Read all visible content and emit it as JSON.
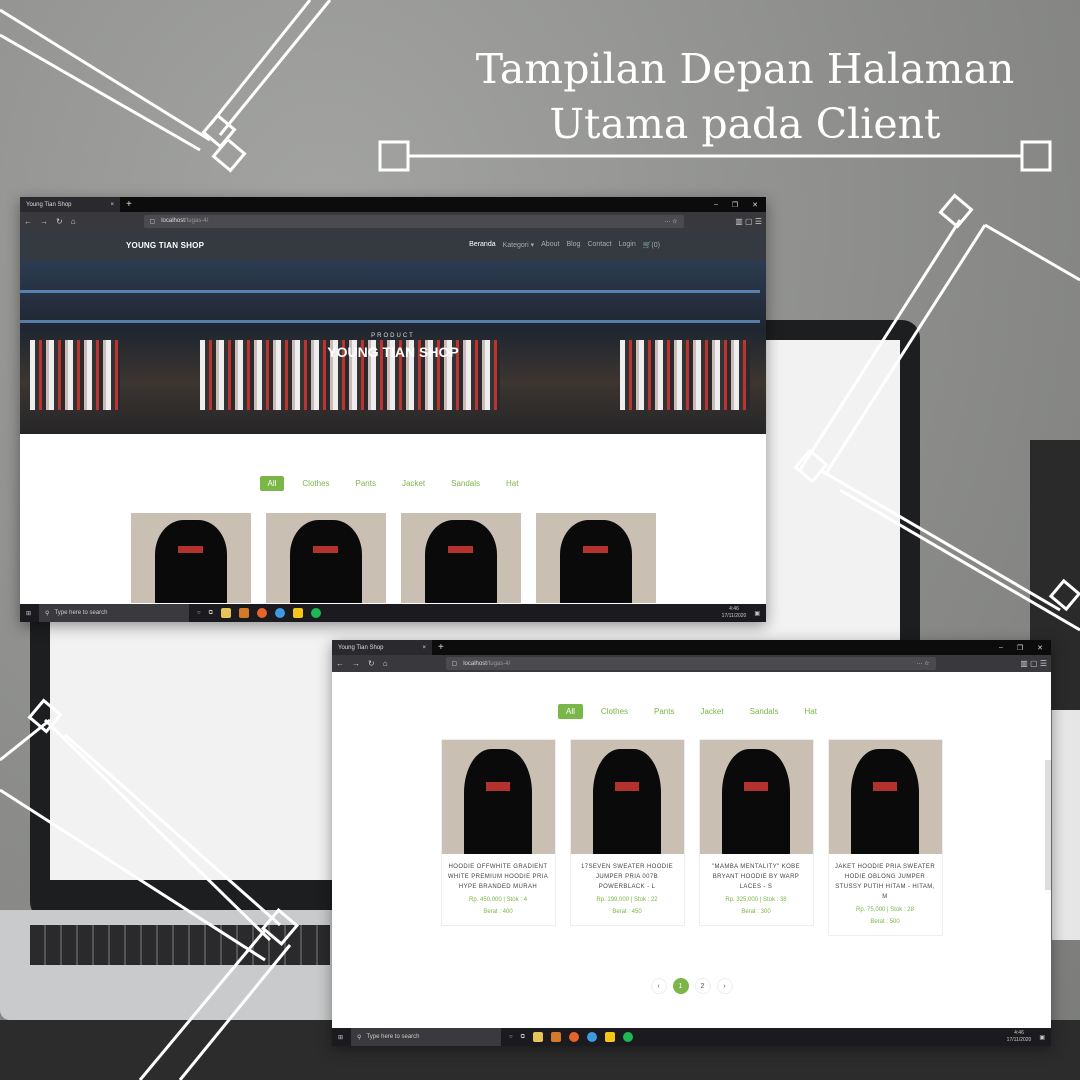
{
  "title": {
    "line1": "Tampilan Depan Halaman",
    "line2": "Utama pada Client"
  },
  "browser": {
    "tab": "Young Tian Shop",
    "close": "×",
    "new_tab": "+",
    "url_host": "localhost",
    "url_path": "/tugas-4/",
    "min": "–",
    "max": "❐",
    "close_win": "✕"
  },
  "nav": {
    "brand": "YOUNG TIAN SHOP",
    "items": [
      "Beranda",
      "Kategori ▾",
      "About",
      "Blog",
      "Contact",
      "Login",
      "🛒(0)"
    ]
  },
  "hero": {
    "subtitle": "PRODUCT",
    "heading": "YOUNG TIAN SHOP"
  },
  "filters": [
    "All",
    "Clothes",
    "Pants",
    "Jacket",
    "Sandals",
    "Hat"
  ],
  "products": [
    {
      "name": "HOODIE OFFWHITE GRADIENT WHITE PREMIUM HOODIE PRIA HYPE BRANDED MURAH",
      "price": "Rp. 450,000 | Stok : 4",
      "weight": "Berat : 400"
    },
    {
      "name": "17SEVEN SWEATER HOODIE JUMPER PRIA 007B POWERBLACK - L",
      "price": "Rp. 199,000 | Stok : 22",
      "weight": "Berat : 450"
    },
    {
      "name": "\"MAMBA MENTALITY\" KOBE BRYANT HOODIE BY WARP LACES - S",
      "price": "Rp. 325,000 | Stok : 38",
      "weight": "Berat : 300"
    },
    {
      "name": "JAKET HOODIE PRIA SWEATER HODIE OBLONG JUMPER STUSSY PUTIH HITAM - HITAM, M",
      "price": "Rp. 75,000 | Stok : 28",
      "weight": "Berat : 500"
    }
  ],
  "pagination": {
    "prev": "‹",
    "pages": [
      "1",
      "2"
    ],
    "next": "›"
  },
  "taskbar": {
    "search_placeholder": "Type here to search",
    "time": "4:46",
    "date": "17/11/2020"
  },
  "colors": {
    "accent": "#7ab648",
    "navbar": "#343a40"
  }
}
